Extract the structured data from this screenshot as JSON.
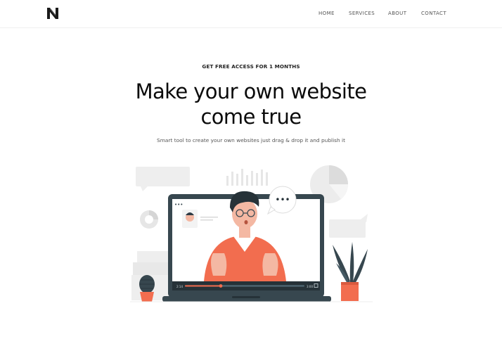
{
  "nav": {
    "links": [
      {
        "label": "HOME"
      },
      {
        "label": "SERVICES"
      },
      {
        "label": "ABOUT"
      },
      {
        "label": "CONTACT"
      }
    ]
  },
  "hero": {
    "eyebrow": "GET FREE ACCESS FOR 1 MONTHS",
    "headline_line1": "Make your own website",
    "headline_line2": "come true",
    "subtitle": "Smart tool to create your own websites just drag & drop it and publish it"
  },
  "illustration": {
    "speech_bubble_text": "•••",
    "window_dots": "•••",
    "video_time": "2:14",
    "video_duration": "3:00",
    "progress": 0.3
  },
  "colors": {
    "accent": "#f26d4f",
    "laptop_frame": "#37474f",
    "plant": "#37474f",
    "light_gray": "#ebebeb"
  }
}
